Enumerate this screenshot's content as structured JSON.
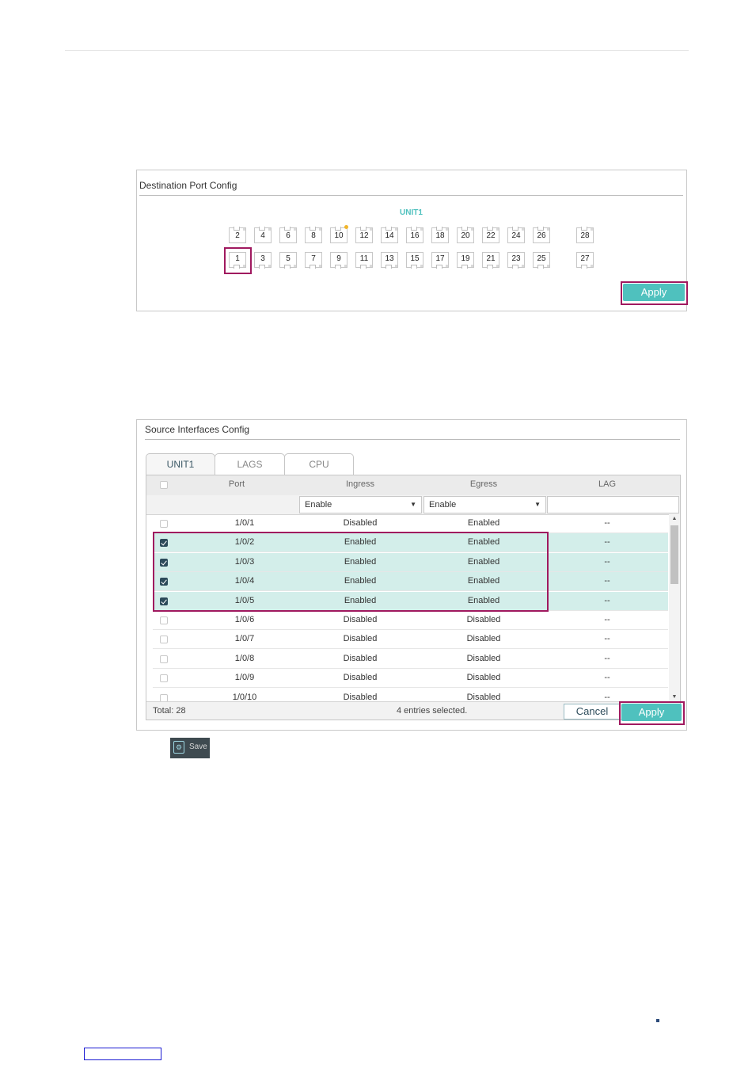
{
  "destination_panel": {
    "title": "Destination Port Config",
    "unit_label": "UNIT1",
    "top_ports": [
      "2",
      "4",
      "6",
      "8",
      "10",
      "12",
      "14",
      "16",
      "18",
      "20",
      "22",
      "24",
      "26",
      "28"
    ],
    "bottom_ports": [
      "1",
      "3",
      "5",
      "7",
      "9",
      "11",
      "13",
      "15",
      "17",
      "19",
      "21",
      "23",
      "25",
      "27"
    ],
    "selected_port": "1",
    "active_port": "10",
    "apply_label": "Apply"
  },
  "source_panel": {
    "title": "Source Interfaces Config",
    "tabs": [
      {
        "label": "UNIT1",
        "active": true
      },
      {
        "label": "LAGS",
        "active": false
      },
      {
        "label": "CPU",
        "active": false
      }
    ],
    "columns": [
      "Port",
      "Ingress",
      "Egress",
      "LAG"
    ],
    "filter": {
      "ingress": "Enable",
      "egress": "Enable"
    },
    "rows": [
      {
        "port": "1/0/1",
        "ingress": "Disabled",
        "egress": "Enabled",
        "lag": "--",
        "checked": false
      },
      {
        "port": "1/0/2",
        "ingress": "Enabled",
        "egress": "Enabled",
        "lag": "--",
        "checked": true
      },
      {
        "port": "1/0/3",
        "ingress": "Enabled",
        "egress": "Enabled",
        "lag": "--",
        "checked": true
      },
      {
        "port": "1/0/4",
        "ingress": "Enabled",
        "egress": "Enabled",
        "lag": "--",
        "checked": true
      },
      {
        "port": "1/0/5",
        "ingress": "Enabled",
        "egress": "Enabled",
        "lag": "--",
        "checked": true
      },
      {
        "port": "1/0/6",
        "ingress": "Disabled",
        "egress": "Disabled",
        "lag": "--",
        "checked": false
      },
      {
        "port": "1/0/7",
        "ingress": "Disabled",
        "egress": "Disabled",
        "lag": "--",
        "checked": false
      },
      {
        "port": "1/0/8",
        "ingress": "Disabled",
        "egress": "Disabled",
        "lag": "--",
        "checked": false
      },
      {
        "port": "1/0/9",
        "ingress": "Disabled",
        "egress": "Disabled",
        "lag": "--",
        "checked": false
      },
      {
        "port": "1/0/10",
        "ingress": "Disabled",
        "egress": "Disabled",
        "lag": "--",
        "checked": false
      }
    ],
    "total": "Total: 28",
    "selected_info": "4 entries selected.",
    "cancel_label": "Cancel",
    "apply_label": "Apply"
  },
  "save_button": {
    "label": "Save",
    "icon": "save-gear-icon"
  },
  "colors": {
    "accent": "#4fc1be",
    "highlight": "#a0195f",
    "selected_row": "#d3eeea",
    "dark": "#2c4b5a"
  }
}
